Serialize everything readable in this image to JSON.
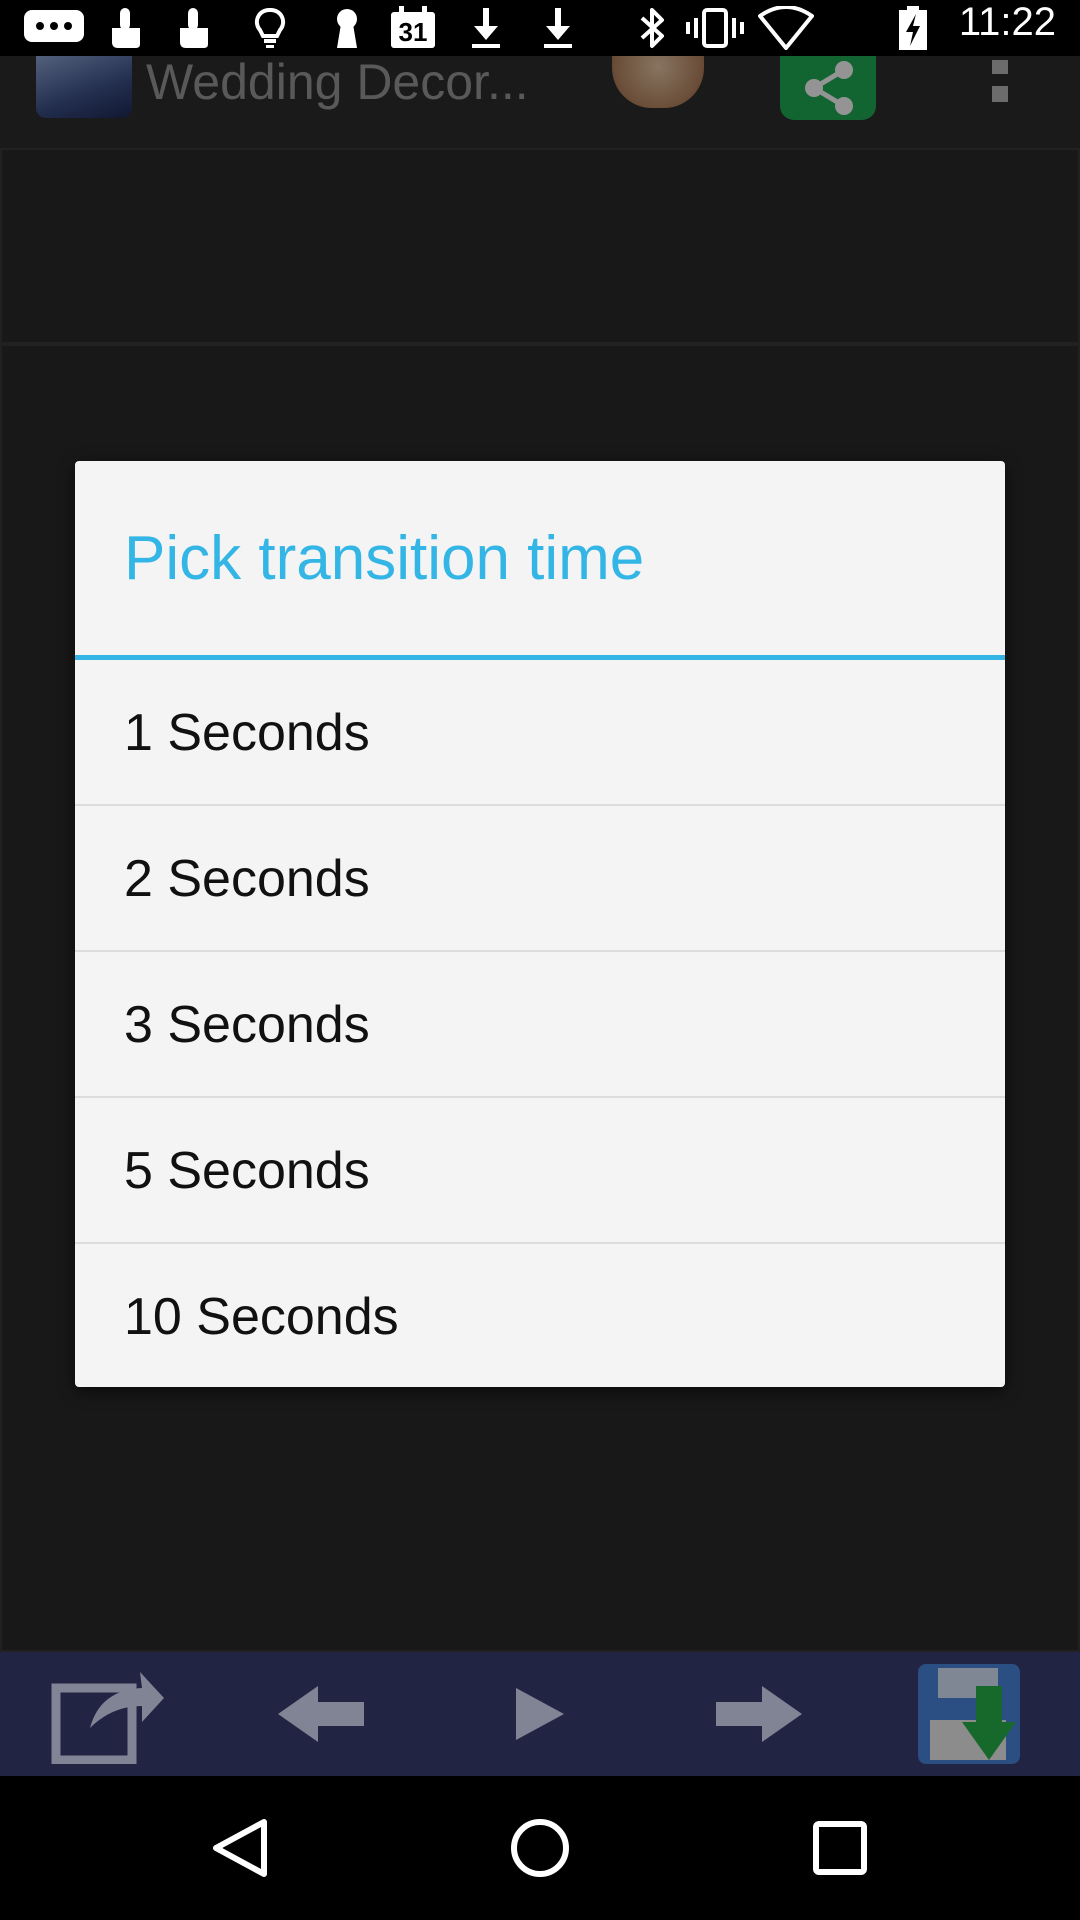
{
  "status_bar": {
    "time": "11:22",
    "calendar_date": "31",
    "icons": [
      "chat-icon",
      "touch-icon",
      "touch-icon",
      "lightbulb-icon",
      "keyhole-icon",
      "calendar-icon",
      "download-icon",
      "download-icon",
      "bluetooth-icon",
      "vibrate-icon",
      "wifi-icon",
      "battery-charging-icon"
    ]
  },
  "app_bar": {
    "title": "Wedding Decor...",
    "icons": [
      "app-thumbnail",
      "hands-image",
      "share-icon",
      "overflow-menu-icon"
    ]
  },
  "dialog": {
    "title": "Pick transition time",
    "options": [
      "1 Seconds",
      "2 Seconds",
      "3 Seconds",
      "5 Seconds",
      "10 Seconds"
    ]
  },
  "toolbar": {
    "icons": [
      "set-wallpaper-icon",
      "previous-arrow-icon",
      "play-icon",
      "next-arrow-icon",
      "save-download-icon"
    ]
  },
  "nav_bar": {
    "icons": [
      "back-icon",
      "home-icon",
      "recents-icon"
    ]
  },
  "colors": {
    "accent": "#33b5e5",
    "dialog_bg": "#f4f4f4",
    "toolbar_bg": "#3c3f75",
    "share_green": "#1fae55"
  }
}
